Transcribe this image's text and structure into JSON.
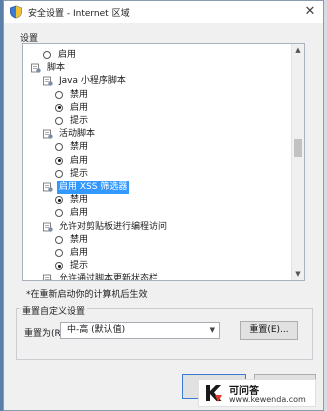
{
  "window": {
    "title": "安全设置 - Internet 区域",
    "close_label": "✕"
  },
  "settings_group_label": "设置",
  "tree": [
    {
      "type": "radio",
      "label": "启用",
      "checked": false,
      "indent": 1
    },
    {
      "type": "node",
      "label": "脚本",
      "indent": 0,
      "selected": false
    },
    {
      "type": "node",
      "label": "Java 小程序脚本",
      "indent": 1,
      "selected": false
    },
    {
      "type": "radio",
      "label": "禁用",
      "checked": false,
      "indent": 2
    },
    {
      "type": "radio",
      "label": "启用",
      "checked": true,
      "indent": 2
    },
    {
      "type": "radio",
      "label": "提示",
      "checked": false,
      "indent": 2
    },
    {
      "type": "node",
      "label": "活动脚本",
      "indent": 1,
      "selected": false
    },
    {
      "type": "radio",
      "label": "禁用",
      "checked": false,
      "indent": 2
    },
    {
      "type": "radio",
      "label": "启用",
      "checked": true,
      "indent": 2
    },
    {
      "type": "radio",
      "label": "提示",
      "checked": false,
      "indent": 2
    },
    {
      "type": "node",
      "label": "启用 XSS 筛选器",
      "indent": 1,
      "selected": true
    },
    {
      "type": "radio",
      "label": "禁用",
      "checked": true,
      "indent": 2
    },
    {
      "type": "radio",
      "label": "启用",
      "checked": false,
      "indent": 2
    },
    {
      "type": "node",
      "label": "允许对剪贴板进行编程访问",
      "indent": 1,
      "selected": false
    },
    {
      "type": "radio",
      "label": "禁用",
      "checked": false,
      "indent": 2
    },
    {
      "type": "radio",
      "label": "启用",
      "checked": false,
      "indent": 2
    },
    {
      "type": "radio",
      "label": "提示",
      "checked": true,
      "indent": 2
    },
    {
      "type": "node",
      "label": "允许通过脚本更新状态栏",
      "indent": 1,
      "selected": false
    }
  ],
  "restart_note": "*在重新启动你的计算机后生效",
  "reset_section": {
    "title": "重置自定义设置",
    "reset_to_label": "重置为(R):",
    "level_value": "中-高 (默认值)",
    "reset_button": "重置(E)..."
  },
  "watermark": {
    "title": "可问答",
    "url": "www.kewenda.com"
  },
  "colors": {
    "selection": "#3399ff",
    "dialog_bg": "#f0f0f0",
    "accent_border": "#3b7bd1"
  }
}
